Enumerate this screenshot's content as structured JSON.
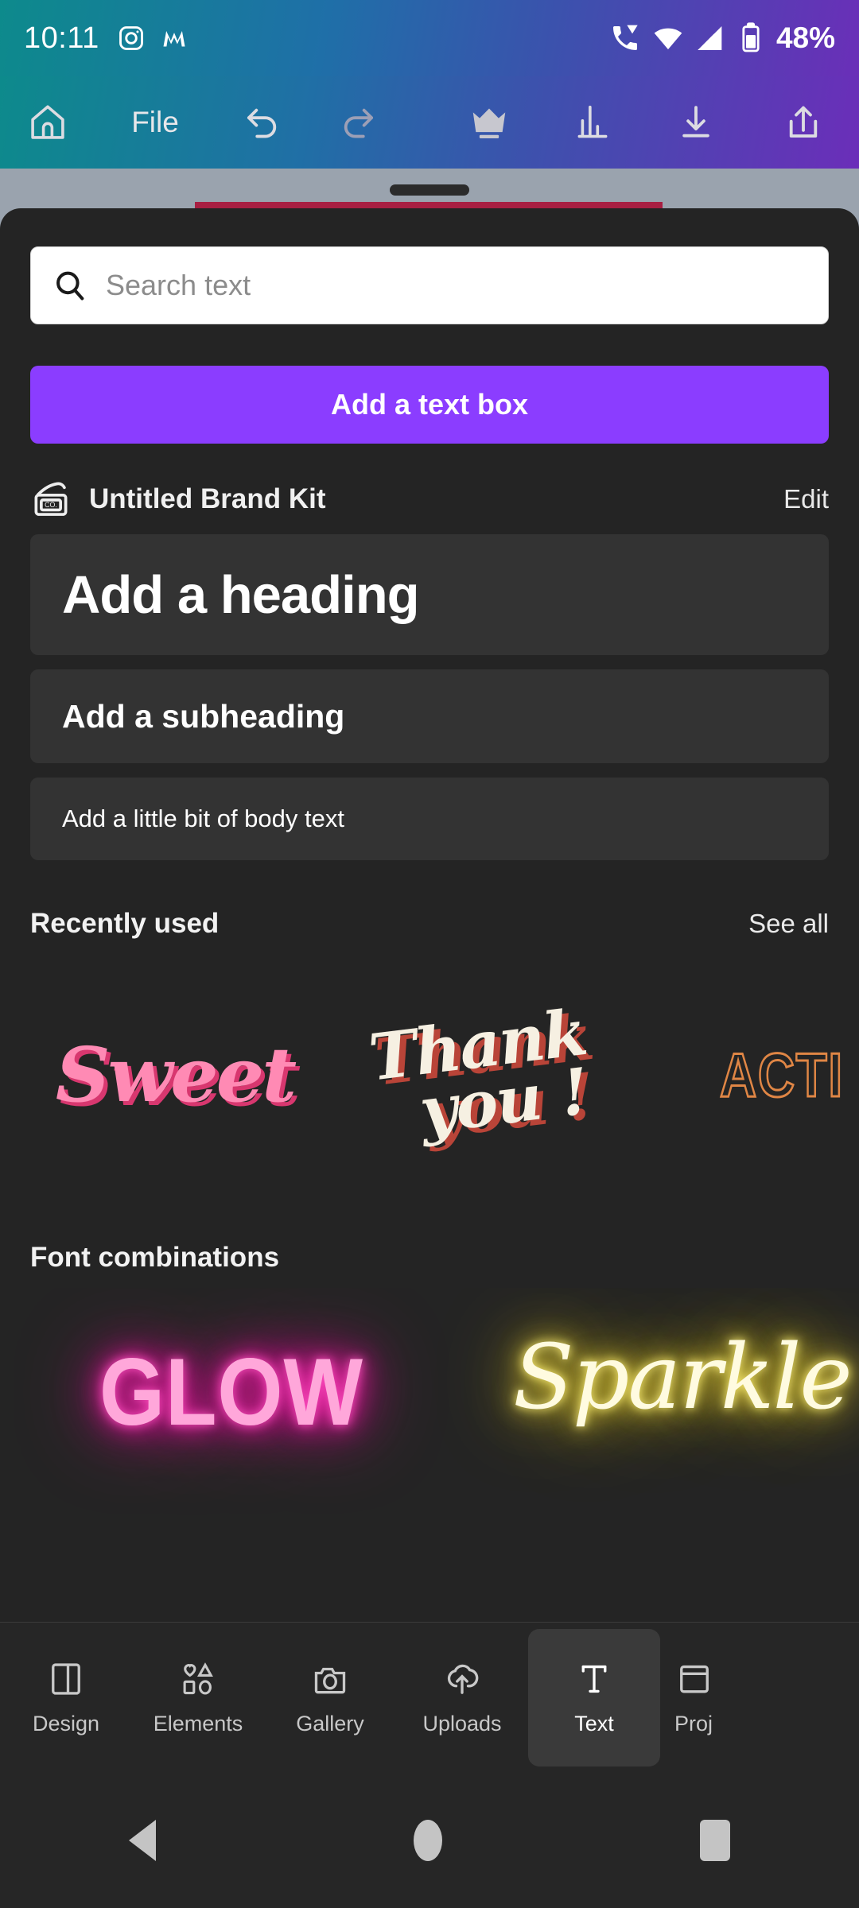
{
  "status_bar": {
    "time": "10:11",
    "battery_percent": "48%",
    "left_icons": [
      "instagram-icon",
      "m-app-icon"
    ],
    "right_icons": [
      "vowifi-call-icon",
      "wifi-icon",
      "cellular-signal-icon",
      "battery-icon"
    ]
  },
  "toolbar": {
    "home_label": "home-icon",
    "file_label": "File",
    "undo_label": "undo-icon",
    "redo_label": "redo-icon",
    "pro_label": "crown-icon",
    "insights_label": "bar-chart-icon",
    "download_label": "download-icon",
    "share_label": "share-icon"
  },
  "search": {
    "placeholder": "Search text",
    "value": ""
  },
  "add_text_box": {
    "label": "Add a text box"
  },
  "brand_kit": {
    "title": "Untitled Brand Kit",
    "edit_label": "Edit"
  },
  "text_presets": [
    {
      "label": "Add a heading"
    },
    {
      "label": "Add a subheading"
    },
    {
      "label": "Add a little bit of body text"
    }
  ],
  "recently_used": {
    "title": "Recently used",
    "see_all_label": "See all",
    "items": [
      {
        "label": "Sweet",
        "color": "#ff8ab4",
        "shadow_color": "#d8376f"
      },
      {
        "label_line1": "Thank",
        "label_line2": "you !",
        "color": "#f6f0e2",
        "shadow_color": "#b94438"
      },
      {
        "label": "ACTI",
        "color": "#e08645"
      }
    ]
  },
  "font_combinations": {
    "title": "Font combinations",
    "items": [
      {
        "label": "GLOW",
        "color": "#ffa7da",
        "glow_color": "#ff1fae"
      },
      {
        "label": "Sparkle",
        "color": "#fffbe0",
        "glow_color": "#f7e043"
      }
    ]
  },
  "bottom_nav": {
    "items": [
      {
        "label": "Design",
        "icon": "layout-icon",
        "active": false
      },
      {
        "label": "Elements",
        "icon": "shapes-icon",
        "active": false
      },
      {
        "label": "Gallery",
        "icon": "camera-icon",
        "active": false
      },
      {
        "label": "Uploads",
        "icon": "cloud-upload-icon",
        "active": false
      },
      {
        "label": "Text",
        "icon": "text-t-icon",
        "active": true
      },
      {
        "label": "Proj",
        "icon": "projects-icon",
        "active": false
      }
    ]
  },
  "android_nav": {
    "back_label": "back-icon",
    "home_label": "home-circle-icon",
    "recents_label": "recents-icon"
  },
  "colors": {
    "accent_purple": "#8b3dff",
    "sheet_bg": "#242424",
    "preset_bg": "#333333",
    "canvas_design": "#a81f42"
  }
}
